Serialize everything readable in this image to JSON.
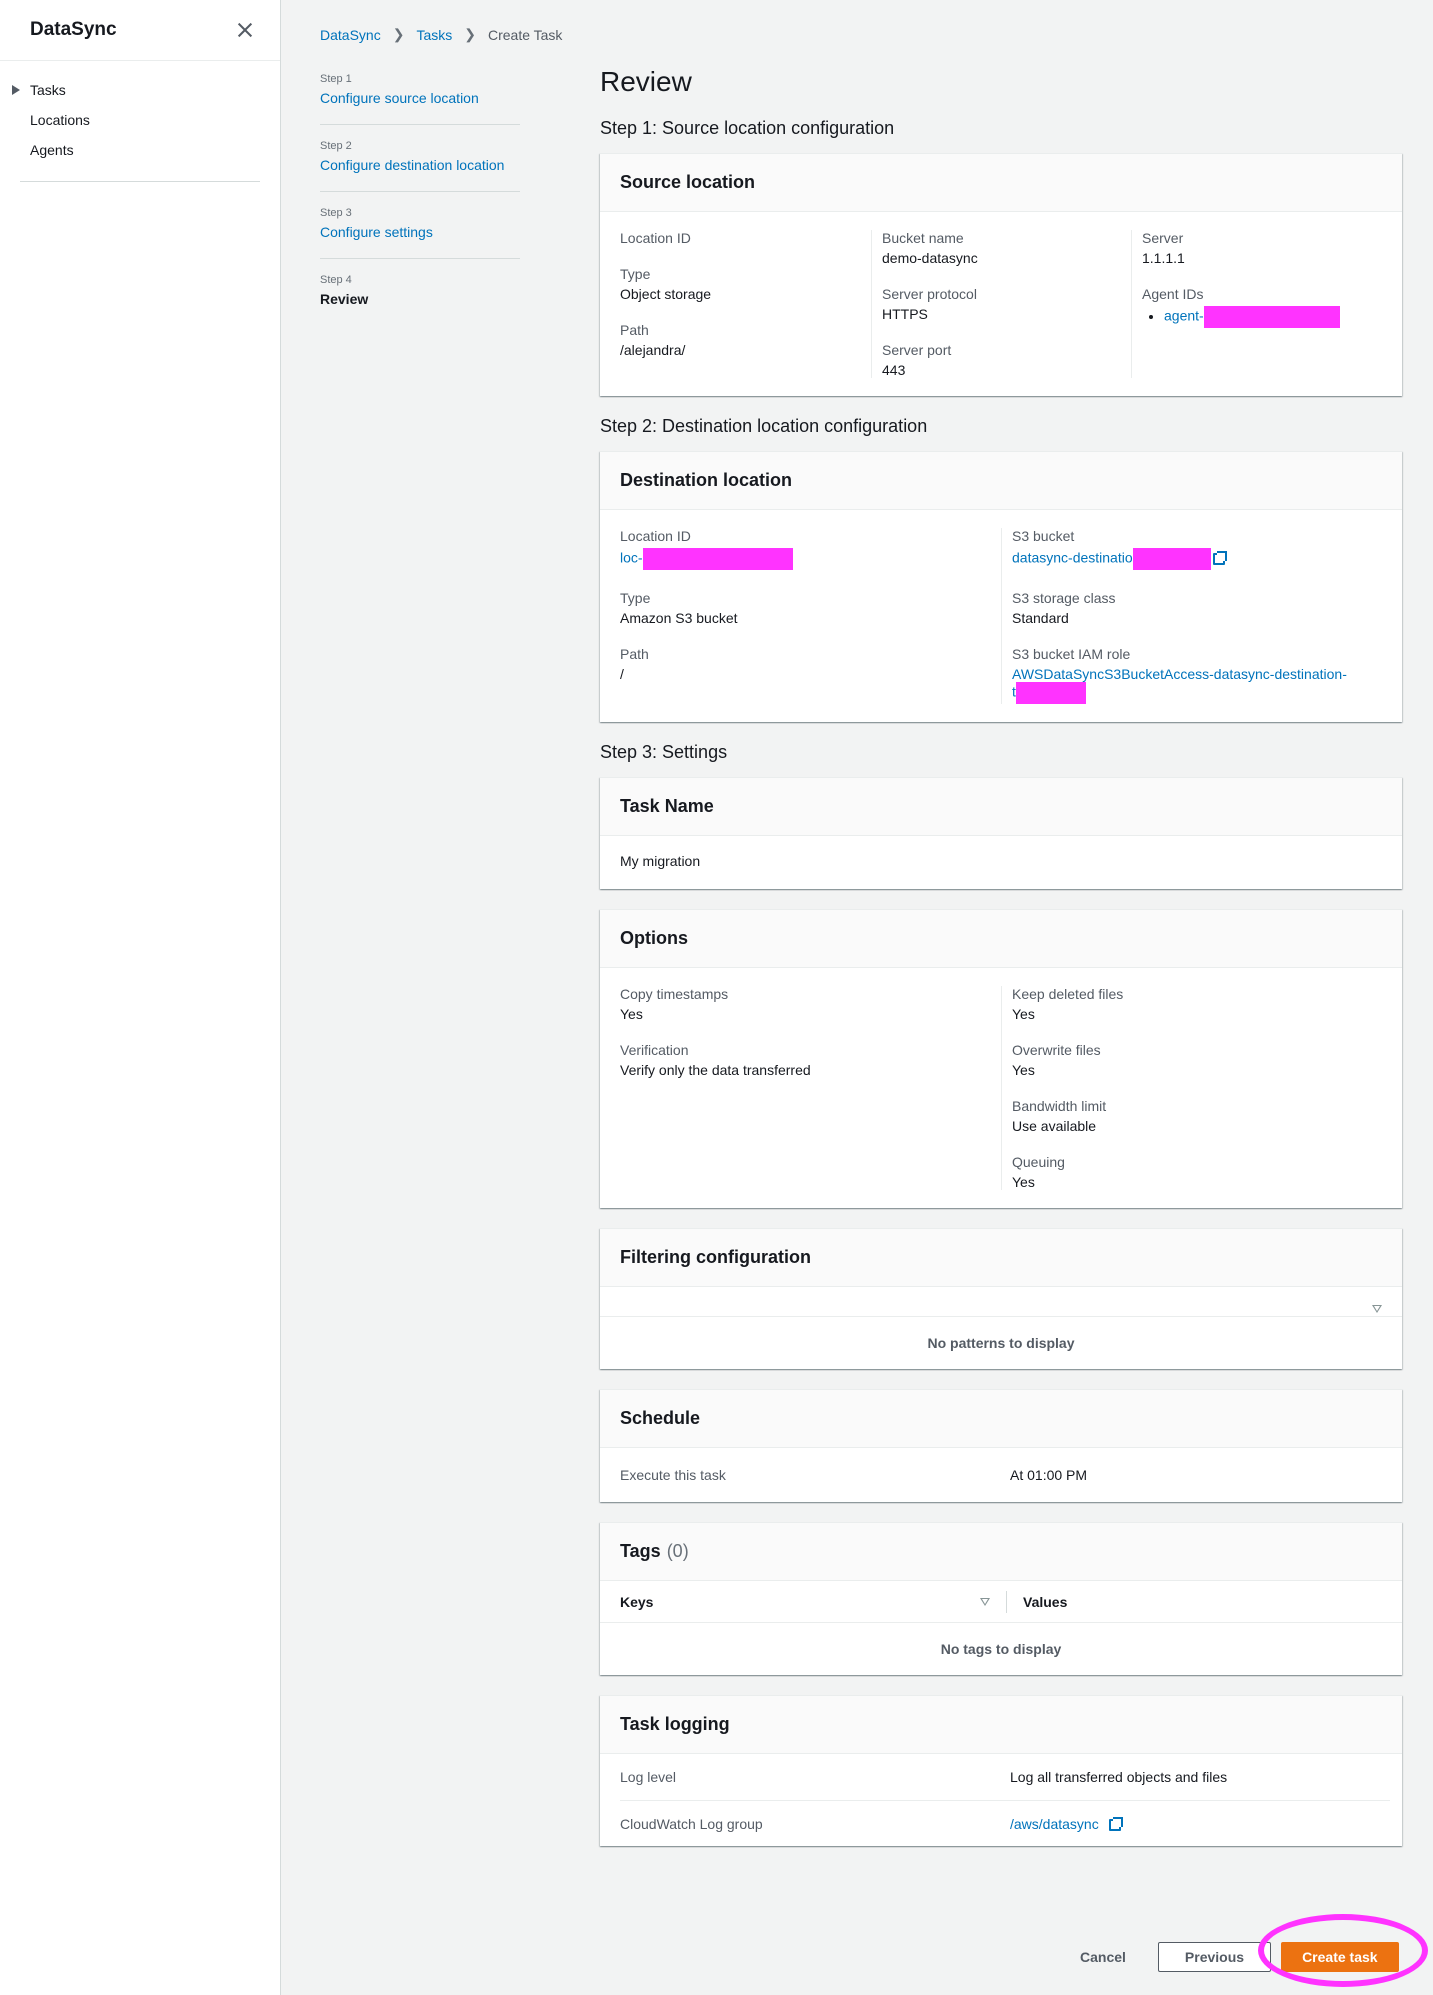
{
  "nav": {
    "title": "DataSync",
    "items": [
      {
        "label": "Tasks"
      },
      {
        "label": "Locations"
      },
      {
        "label": "Agents"
      }
    ]
  },
  "breadcrumb": [
    "DataSync",
    "Tasks",
    "Create Task"
  ],
  "steps": [
    {
      "num": "Step 1",
      "label": "Configure source location"
    },
    {
      "num": "Step 2",
      "label": "Configure destination location"
    },
    {
      "num": "Step 3",
      "label": "Configure settings"
    },
    {
      "num": "Step 4",
      "label": "Review"
    }
  ],
  "page_title": "Review",
  "sections": {
    "step1": "Step 1: Source location configuration",
    "step2": "Step 2: Destination location configuration",
    "step3": "Step 3: Settings"
  },
  "source": {
    "title": "Source location",
    "location_id_label": "Location ID",
    "type_label": "Type",
    "type_value": "Object storage",
    "path_label": "Path",
    "path_value": "/alejandra/",
    "bucket_label": "Bucket name",
    "bucket_value": "demo-datasync",
    "protocol_label": "Server protocol",
    "protocol_value": "HTTPS",
    "port_label": "Server port",
    "port_value": "443",
    "server_label": "Server",
    "server_value": "1.1.1.1",
    "agents_label": "Agent IDs",
    "agent_prefix": "agent-"
  },
  "destination": {
    "title": "Destination location",
    "location_id_label": "Location ID",
    "location_id_prefix": "loc-",
    "type_label": "Type",
    "type_value": "Amazon S3 bucket",
    "path_label": "Path",
    "path_value": "/",
    "s3_bucket_label": "S3 bucket",
    "s3_bucket_prefix": "datasync-destinatio",
    "storage_class_label": "S3 storage class",
    "storage_class_value": "Standard",
    "iam_role_label": "S3 bucket IAM role",
    "iam_role_value": "AWSDataSyncS3BucketAccess-datasync-destination-",
    "iam_role_line2": "t"
  },
  "task_name": {
    "title": "Task Name",
    "value": "My migration"
  },
  "options": {
    "title": "Options",
    "copy_timestamps_label": "Copy timestamps",
    "copy_timestamps_value": "Yes",
    "verification_label": "Verification",
    "verification_value": "Verify only the data transferred",
    "keep_deleted_label": "Keep deleted files",
    "keep_deleted_value": "Yes",
    "overwrite_label": "Overwrite files",
    "overwrite_value": "Yes",
    "bandwidth_label": "Bandwidth limit",
    "bandwidth_value": "Use available",
    "queuing_label": "Queuing",
    "queuing_value": "Yes"
  },
  "filtering": {
    "title": "Filtering configuration",
    "empty": "No patterns to display"
  },
  "schedule": {
    "title": "Schedule",
    "label": "Execute this task",
    "value": "At 01:00 PM"
  },
  "tags": {
    "title": "Tags",
    "count": "(0)",
    "col_keys": "Keys",
    "col_values": "Values",
    "empty": "No tags to display"
  },
  "logging": {
    "title": "Task logging",
    "level_label": "Log level",
    "level_value": "Log all transferred objects and files",
    "group_label": "CloudWatch Log group",
    "group_value": "/aws/datasync"
  },
  "actions": {
    "cancel": "Cancel",
    "previous": "Previous",
    "create": "Create task"
  },
  "colors": {
    "primary": "#ec7211",
    "link": "#0073bb",
    "redaction": "#ff33ff"
  }
}
